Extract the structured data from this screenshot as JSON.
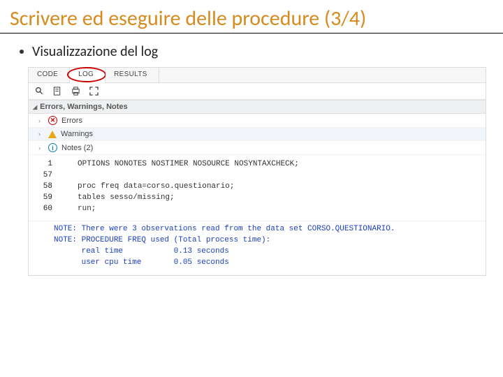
{
  "slide": {
    "title": "Scrivere ed eseguire delle procedure (3/4)",
    "bullet": "Visualizzazione del log"
  },
  "tabs": {
    "code": "CODE",
    "log": "LOG",
    "results": "RESULTS"
  },
  "section_header": "Errors, Warnings, Notes",
  "ewn": {
    "errors": "Errors",
    "warnings": "Warnings",
    "notes": "Notes (2)"
  },
  "code": {
    "l1_num": "1",
    "l1_txt": "OPTIONS NONOTES NOSTIMER NOSOURCE NOSYNTAXCHECK;",
    "l2_num": "57",
    "l2_txt": "proc freq data=corso.questionario;",
    "l3_num": "58",
    "l3_txt": "",
    "l4_num": "59",
    "l4_txt": "tables sesso/missing;",
    "l5_num": "60",
    "l5_txt": "run;"
  },
  "notes": "NOTE: There were 3 observations read from the data set CORSO.QUESTIONARIO.\nNOTE: PROCEDURE FREQ used (Total process time):\n      real time           0.13 seconds\n      user cpu time       0.05 seconds"
}
